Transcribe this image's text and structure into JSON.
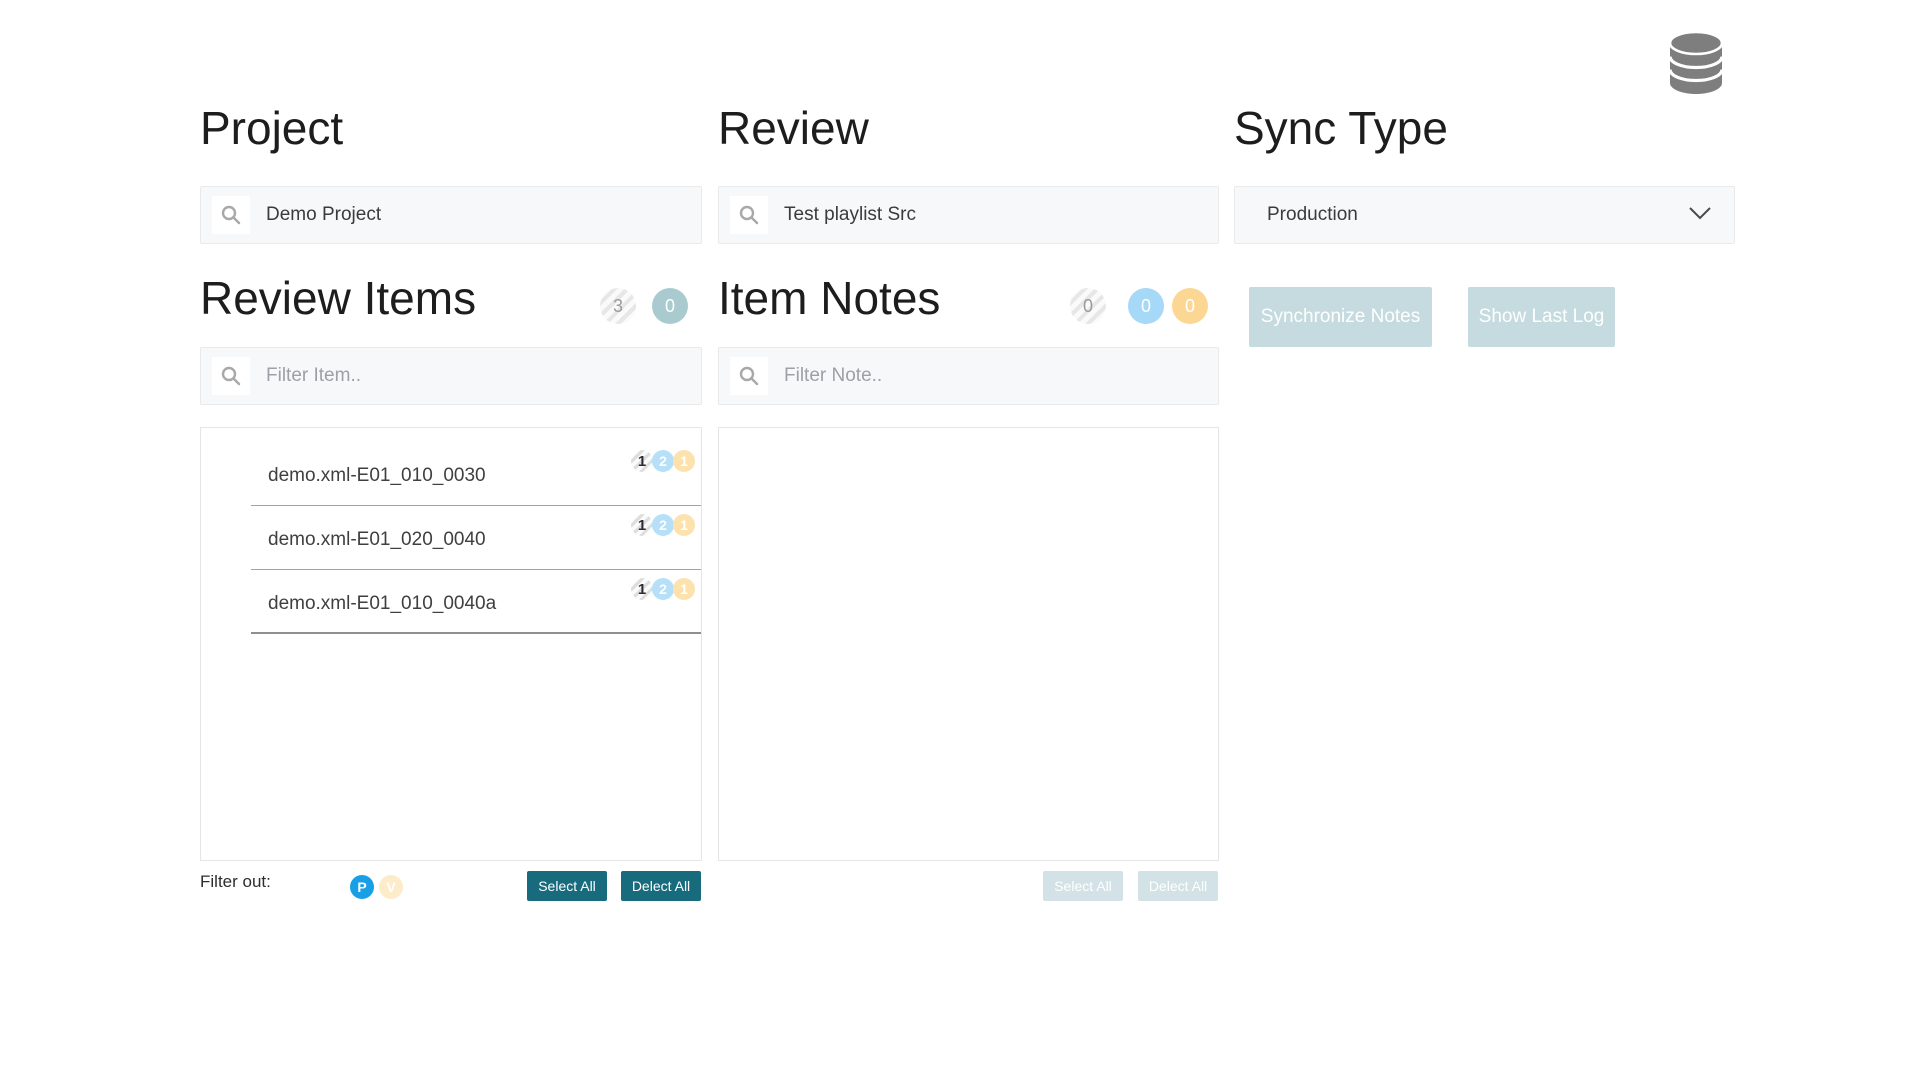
{
  "project": {
    "title": "Project",
    "search_value": "Demo Project"
  },
  "review": {
    "title": "Review",
    "search_value": "Test playlist Src"
  },
  "sync_type": {
    "title": "Sync Type",
    "selected_option": "Production"
  },
  "actions": {
    "synchronize_label": "Synchronize Notes",
    "show_log_label": "Show Last Log"
  },
  "review_items": {
    "title": "Review Items",
    "badge_total": "3",
    "badge_selected": "0",
    "filter_placeholder": "Filter Item..",
    "items": [
      {
        "name": "demo.xml-E01_010_0030",
        "count_total": "1",
        "count_publish": "2",
        "count_version": "1"
      },
      {
        "name": "demo.xml-E01_020_0040",
        "count_total": "1",
        "count_publish": "2",
        "count_version": "1"
      },
      {
        "name": "demo.xml-E01_010_0040a",
        "count_total": "1",
        "count_publish": "2",
        "count_version": "1"
      }
    ],
    "filter_out_label": "Filter out:",
    "filter_publish_label": "P",
    "filter_version_label": "V",
    "select_all_label": "Select All",
    "delect_all_label": "Delect All"
  },
  "item_notes": {
    "title": "Item Notes",
    "badge_total": "0",
    "badge_publish": "0",
    "badge_version": "0",
    "filter_placeholder": "Filter Note..",
    "select_all_label": "Select All",
    "delect_all_label": "Delect All"
  },
  "colors": {
    "teal_badge": "#a9cbd0",
    "blue_badge": "#a6d8f8",
    "yellow_badge": "#fbd793",
    "dark_button_teal": "#176b7d",
    "disabled_button": "#c5dbdf",
    "publish_blue": "#189fe5",
    "version_yellow": "#fcecca",
    "icon_gray": "#7e7e7e"
  }
}
